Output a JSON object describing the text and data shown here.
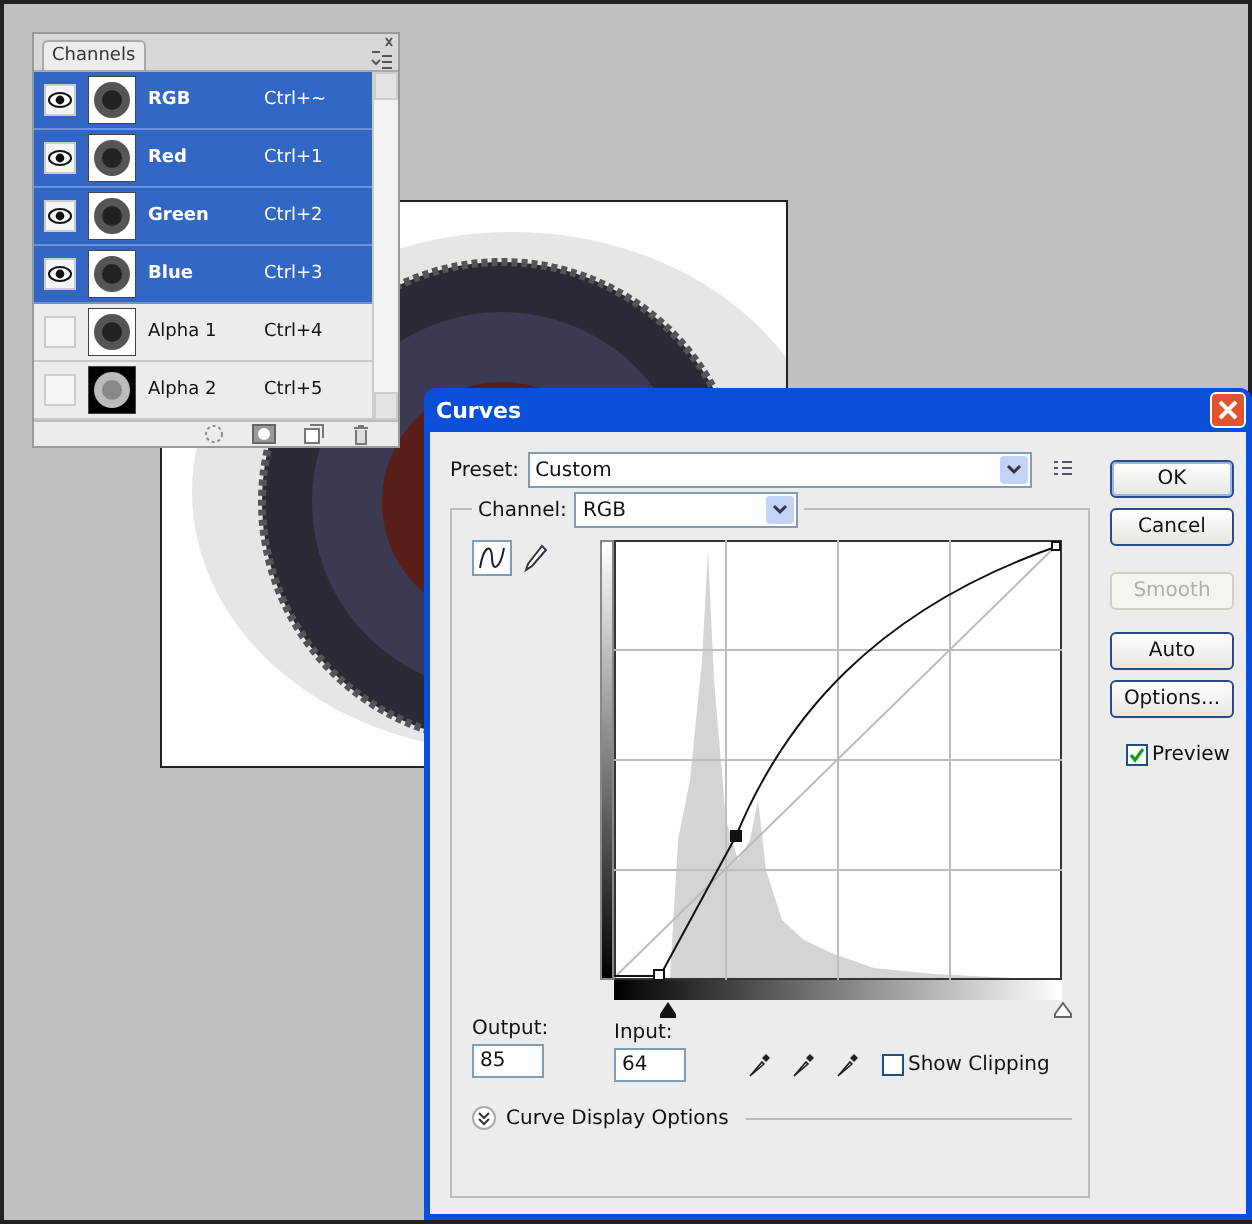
{
  "channels_panel": {
    "tab": "Channels",
    "rows": [
      {
        "name": "RGB",
        "shortcut": "Ctrl+~",
        "visible": true,
        "selected": true
      },
      {
        "name": "Red",
        "shortcut": "Ctrl+1",
        "visible": true,
        "selected": true
      },
      {
        "name": "Green",
        "shortcut": "Ctrl+2",
        "visible": true,
        "selected": true
      },
      {
        "name": "Blue",
        "shortcut": "Ctrl+3",
        "visible": true,
        "selected": true
      },
      {
        "name": "Alpha 1",
        "shortcut": "Ctrl+4",
        "visible": false,
        "selected": false
      },
      {
        "name": "Alpha 2",
        "shortcut": "Ctrl+5",
        "visible": false,
        "selected": false
      }
    ]
  },
  "curves_dialog": {
    "title": "Curves",
    "preset_label": "Preset:",
    "preset": "Custom",
    "channel_label": "Channel:",
    "channel": "RGB",
    "tools": [
      {
        "kind": "curve",
        "selected": true
      },
      {
        "kind": "pencil",
        "selected": false
      }
    ],
    "buttons": [
      {
        "label": "OK",
        "default": true,
        "disabled": false
      },
      {
        "label": "Cancel",
        "default": false,
        "disabled": false
      },
      {
        "label": "Smooth",
        "default": false,
        "disabled": true
      },
      {
        "label": "Auto",
        "default": false,
        "disabled": false
      },
      {
        "label": "Options...",
        "default": false,
        "disabled": false
      }
    ],
    "preview": {
      "label": "Preview",
      "checked": true
    },
    "input_sliders": [
      {
        "kind": "shadow",
        "level": 0.12
      },
      {
        "kind": "highlight",
        "level": 1
      }
    ],
    "output_label": "Output:",
    "output": "85",
    "input_label": "Input:",
    "input": "64",
    "show_clipping": {
      "label": "Show Clipping",
      "checked": false
    },
    "display_options": "Curve Display Options"
  }
}
